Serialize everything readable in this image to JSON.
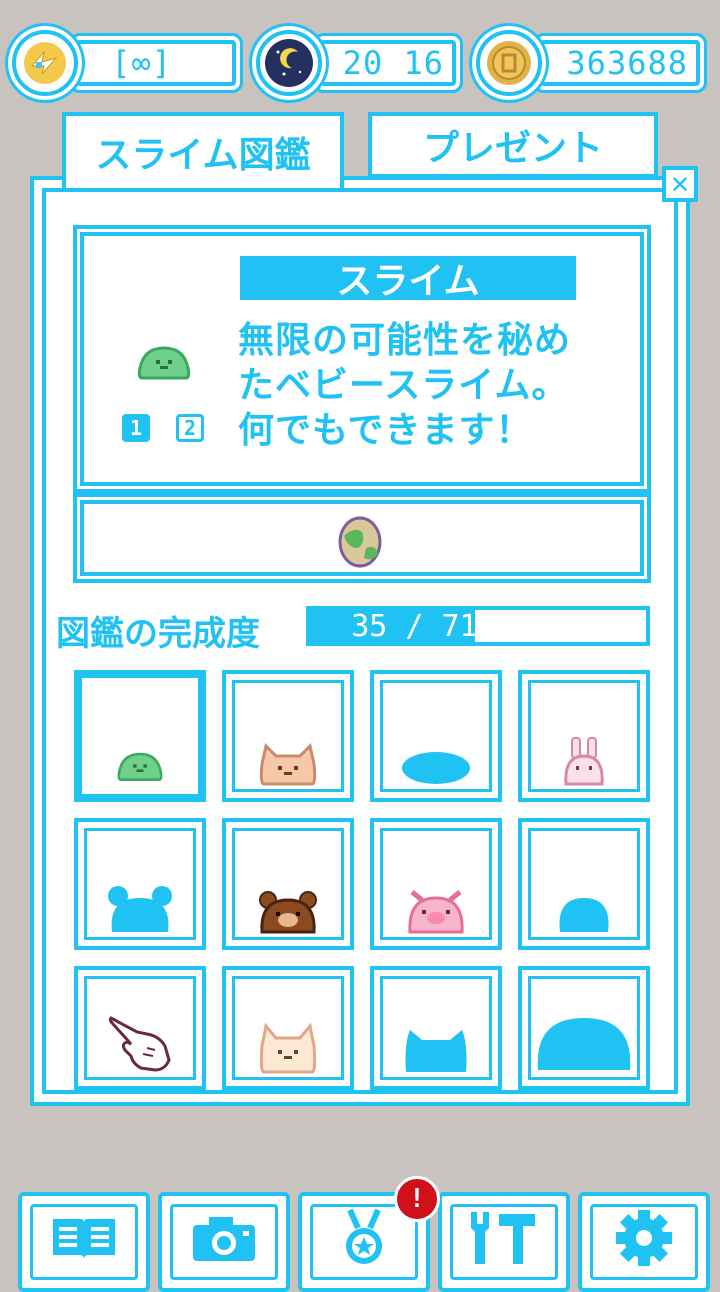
{
  "colors": {
    "accent": "#1fc2f2",
    "background": "#c8c3bf",
    "badge": "#d0101b"
  },
  "status_bar": {
    "energy": {
      "icon": "lightning-bird-icon",
      "value": "[∞]"
    },
    "time": {
      "icon": "night-moon-icon",
      "value": "20 16"
    },
    "coins": {
      "icon": "coin-icon",
      "value": "363688"
    }
  },
  "tabs": [
    {
      "label": "スライム図鑑",
      "active": true
    },
    {
      "label": "プレゼント",
      "active": false
    }
  ],
  "close_label": "✕",
  "detail": {
    "name": "スライム",
    "description_lines": [
      "無限の可能性を秘め",
      "たベビースライム。",
      "何でもできます！"
    ],
    "pages": [
      "1",
      "2"
    ],
    "active_page": "1",
    "slime_icon": "green-slime-icon",
    "item_icon": "earth-egg-icon"
  },
  "completion": {
    "label": "図鑑の完成度",
    "text": "35 / 71 (49%)",
    "collected": 35,
    "total": 71,
    "percent": 49
  },
  "grid": [
    {
      "icon": "green-slime-icon",
      "selected": true
    },
    {
      "icon": "cat-slime-icon",
      "selected": false
    },
    {
      "icon": "unknown-flat-slime-icon",
      "selected": false
    },
    {
      "icon": "rabbit-slime-icon",
      "selected": false
    },
    {
      "icon": "unknown-bear-silhouette-icon",
      "selected": false
    },
    {
      "icon": "bear-slime-icon",
      "selected": false
    },
    {
      "icon": "pig-slime-icon",
      "selected": false
    },
    {
      "icon": "unknown-round-slime-icon",
      "selected": false
    },
    {
      "icon": "pointing-hand-icon",
      "selected": false
    },
    {
      "icon": "cream-cat-slime-icon",
      "selected": false
    },
    {
      "icon": "unknown-cat-silhouette-icon",
      "selected": false
    },
    {
      "icon": "unknown-big-slime-icon",
      "selected": false
    }
  ],
  "bottom_nav": [
    {
      "icon": "book-icon"
    },
    {
      "icon": "camera-icon"
    },
    {
      "icon": "medal-icon",
      "badge": "!"
    },
    {
      "icon": "tools-icon"
    },
    {
      "icon": "settings-gear-icon"
    }
  ]
}
